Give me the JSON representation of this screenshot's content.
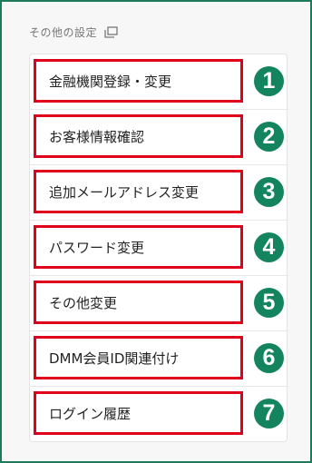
{
  "section": {
    "title": "その他の設定",
    "icon": "copy-icon"
  },
  "menu": {
    "items": [
      {
        "label": "金融機関登録・変更",
        "number": "1"
      },
      {
        "label": "お客様情報確認",
        "number": "2"
      },
      {
        "label": "追加メールアドレス変更",
        "number": "3"
      },
      {
        "label": "パスワード変更",
        "number": "4"
      },
      {
        "label": "その他変更",
        "number": "5"
      },
      {
        "label": "DMM会員ID関連付け",
        "number": "6"
      },
      {
        "label": "ログイン履歴",
        "number": "7"
      }
    ]
  },
  "colors": {
    "frame_border": "#1f7a5c",
    "highlight_border": "#e0001b",
    "badge": "#14845f"
  }
}
